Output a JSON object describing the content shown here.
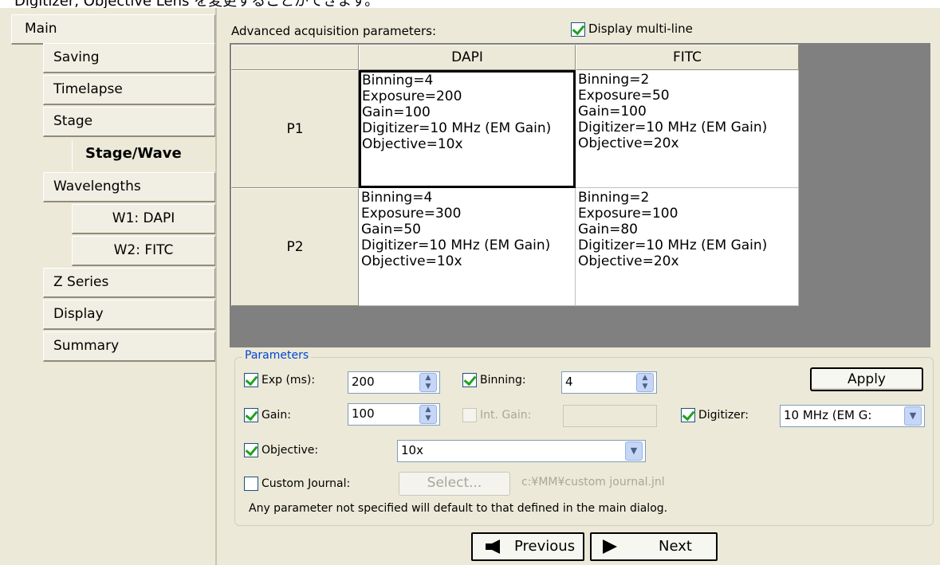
{
  "top_caption": "Digitizer, Objective Lens を変更することができます。",
  "sidebar": {
    "main": "Main",
    "items": [
      "Saving",
      "Timelapse",
      "Stage"
    ],
    "stage_wave": "Stage/Wave",
    "wavelengths": "Wavelengths",
    "w1": "W1: DAPI",
    "w2": "W2: FITC",
    "z_series": "Z Series",
    "display": "Display",
    "summary": "Summary"
  },
  "advanced": {
    "label": "Advanced acquisition parameters:",
    "display_multiline": "Display multi-line"
  },
  "grid": {
    "columns": [
      "DAPI",
      "FITC"
    ],
    "rows": [
      {
        "name": "P1",
        "cells": [
          [
            "Binning=4",
            "Exposure=200",
            "Gain=100",
            "Digitizer=10 MHz (EM Gain)",
            "Objective=10x"
          ],
          [
            "Binning=2",
            "Exposure=50",
            "Gain=100",
            "Digitizer=10 MHz (EM Gain)",
            "Objective=20x"
          ]
        ]
      },
      {
        "name": "P2",
        "cells": [
          [
            "Binning=4",
            "Exposure=300",
            "Gain=50",
            "Digitizer=10 MHz (EM Gain)",
            "Objective=10x"
          ],
          [
            "Binning=2",
            "Exposure=100",
            "Gain=80",
            "Digitizer=10 MHz (EM Gain)",
            "Objective=20x"
          ]
        ]
      }
    ]
  },
  "parameters": {
    "legend": "Parameters",
    "exp_label": "Exp (ms):",
    "exp_value": "200",
    "binning_label": "Binning:",
    "binning_value": "4",
    "apply": "Apply",
    "gain_label": "Gain:",
    "gain_value": "100",
    "int_gain_label": "Int. Gain:",
    "int_gain_value": "",
    "digitizer_label": "Digitizer:",
    "digitizer_value": "10 MHz (EM G:",
    "objective_label": "Objective:",
    "objective_value": "10x",
    "custom_journal_label": "Custom Journal:",
    "select_button": "Select...",
    "journal_path": "c:¥MM¥custom journal.jnl",
    "hint": "Any parameter not specified will default to that defined in the main dialog."
  },
  "nav": {
    "previous": "Previous",
    "next": "Next"
  }
}
